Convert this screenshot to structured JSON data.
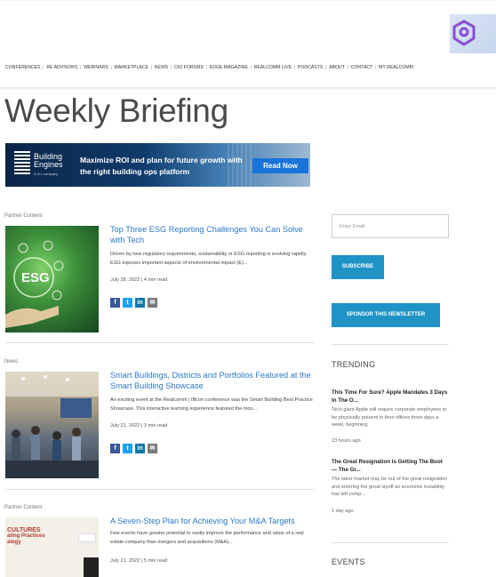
{
  "nav": {
    "items": [
      "CONFERENCES",
      "RE ADVISORS",
      "WEBINARS",
      "MARKETPLACE",
      "NEWS",
      "CIO FORUMS",
      "EDGE MAGAZINE",
      "REALCOMM LIVE",
      "PODCASTS",
      "ABOUT",
      "CONTACT",
      "MY REALCOMM"
    ],
    "separator": "|"
  },
  "page_title": "Weekly Briefing",
  "banner": {
    "brand_line1": "Building",
    "brand_line2": "Engines",
    "brand_sub": "A JLL company",
    "slogan": "Maximize ROI and plan for future growth with the right building ops platform",
    "cta": "Read Now"
  },
  "articles": [
    {
      "label": "Partner Content",
      "title": "Top Three ESG Reporting Challenges You Can Solve with Tech",
      "excerpt": "Driven by new regulatory requirements, sustainability or ESG reporting is evolving rapidly. ESG exposes important aspects of environmental impact (E)...",
      "meta": "July 28, 2022 | 4 min read",
      "thumb_text": "ESG"
    },
    {
      "label": "News",
      "title": "Smart Buildings, Districts and Portfolios Featured at the Smart Building Showcase",
      "excerpt": "An exciting event at the Realcomm | IBcon conference was the Smart Building Best Practice Showcase. This interactive learning experience featured the mos...",
      "meta": "July 21, 2022 | 3 min read"
    },
    {
      "label": "Partner Content",
      "title": "A Seven-Step Plan for Achieving Your M&A Targets",
      "excerpt": "Few events have greater potential to vastly improve the performance and value of a real estate company than mergers and acquisitions (M&A)...",
      "meta": "July 21, 2022 | 5 min read",
      "thumb_lines": [
        "CULTURES",
        "ating Practices",
        "ategy"
      ]
    }
  ],
  "share_icons": [
    "f",
    "t",
    "in",
    "✉"
  ],
  "sidebar": {
    "email_placeholder": "Enter Email",
    "subscribe": "SUBSCRIBE",
    "sponsor": "SPONSOR THIS NEWSLETTER",
    "trending_heading": "TRENDING",
    "trending": [
      {
        "title": "This Time For Sure? Apple Mandates 3 Days In The O...",
        "text": "Tech giant Apple will require corporate employees to be physically present in their offices three days a week, beginning",
        "time": "23 hours ago"
      },
      {
        "title": "The Great Resignation Is Getting The Boot — The Gr...",
        "text": "The labor market may be out of the great resignation and entering the great layoff as economic instability has left comp...",
        "time": "1 day ago"
      }
    ],
    "events_heading": "EVENTS"
  },
  "colors": {
    "link": "#2a78c5",
    "button": "#1f93c6",
    "banner_dark": "#0b2447",
    "banner_cta": "#1a73d9"
  }
}
